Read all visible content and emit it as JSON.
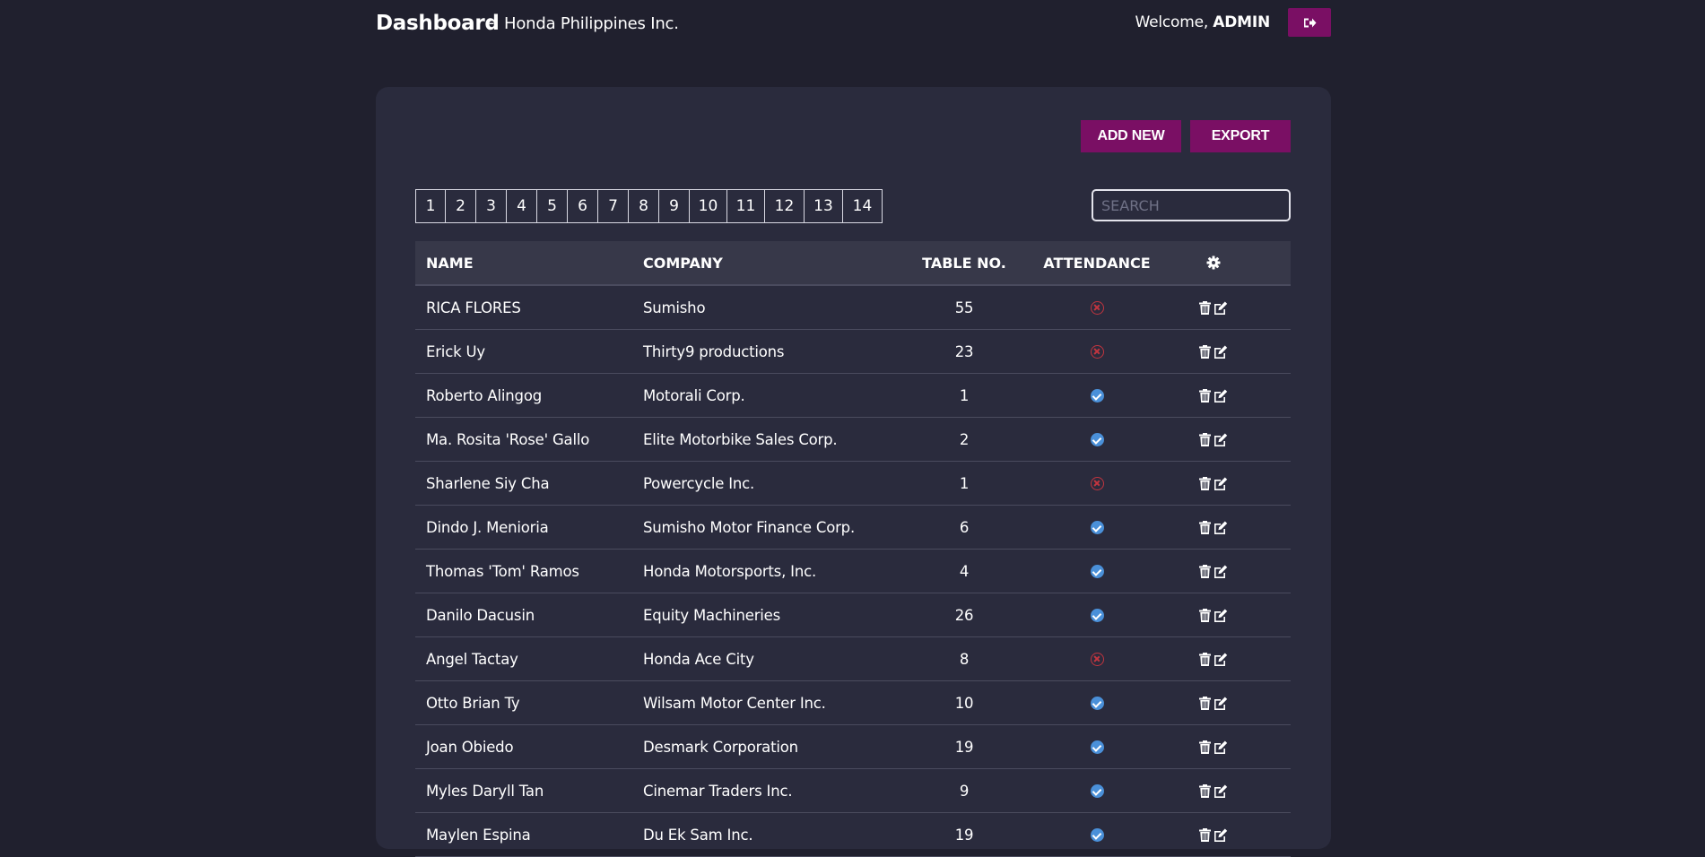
{
  "header": {
    "title": "Dashboard",
    "separator": "-",
    "subtitle": "Honda Philippines Inc.",
    "welcome_prefix": "Welcome, ",
    "username": "ADMIN",
    "logout_icon": "sign-out-icon"
  },
  "toolbar": {
    "add_label": "ADD NEW",
    "export_label": "EXPORT"
  },
  "pagination": {
    "pages": [
      "1",
      "2",
      "3",
      "4",
      "5",
      "6",
      "7",
      "8",
      "9",
      "10",
      "11",
      "12",
      "13",
      "14"
    ]
  },
  "search": {
    "placeholder": "SEARCH",
    "value": ""
  },
  "table": {
    "columns": {
      "name": "NAME",
      "company": "COMPANY",
      "table_no": "TABLE NO.",
      "attendance": "ATTENDANCE",
      "actions_icon": "gear-icon"
    },
    "rows": [
      {
        "name": "RICA FLORES",
        "company": "Sumisho",
        "table_no": "55",
        "attended": false
      },
      {
        "name": "Erick Uy",
        "company": "Thirty9 productions",
        "table_no": "23",
        "attended": false
      },
      {
        "name": "Roberto Alingog",
        "company": "Motorali Corp.",
        "table_no": "1",
        "attended": true
      },
      {
        "name": "Ma. Rosita 'Rose' Gallo",
        "company": "Elite Motorbike Sales Corp.",
        "table_no": "2",
        "attended": true
      },
      {
        "name": "Sharlene Siy Cha",
        "company": "Powercycle Inc.",
        "table_no": "1",
        "attended": false
      },
      {
        "name": "Dindo J. Menioria",
        "company": "Sumisho Motor Finance Corp.",
        "table_no": "6",
        "attended": true
      },
      {
        "name": "Thomas 'Tom' Ramos",
        "company": "Honda Motorsports, Inc.",
        "table_no": "4",
        "attended": true
      },
      {
        "name": "Danilo Dacusin",
        "company": "Equity Machineries",
        "table_no": "26",
        "attended": true
      },
      {
        "name": "Angel Tactay",
        "company": "Honda Ace City",
        "table_no": "8",
        "attended": false
      },
      {
        "name": "Otto Brian Ty",
        "company": "Wilsam Motor Center Inc.",
        "table_no": "10",
        "attended": true
      },
      {
        "name": "Joan Obiedo",
        "company": "Desmark Corporation",
        "table_no": "19",
        "attended": true
      },
      {
        "name": "Myles Daryll Tan",
        "company": "Cinemar Traders Inc.",
        "table_no": "9",
        "attended": true
      },
      {
        "name": "Maylen Espina",
        "company": "Du Ek Sam Inc.",
        "table_no": "19",
        "attended": true
      }
    ]
  },
  "colors": {
    "background": "#20202e",
    "panel": "#2a2b3d",
    "accent": "#7a0f64",
    "attended": "#4a90d9",
    "absent": "#c2353f"
  }
}
